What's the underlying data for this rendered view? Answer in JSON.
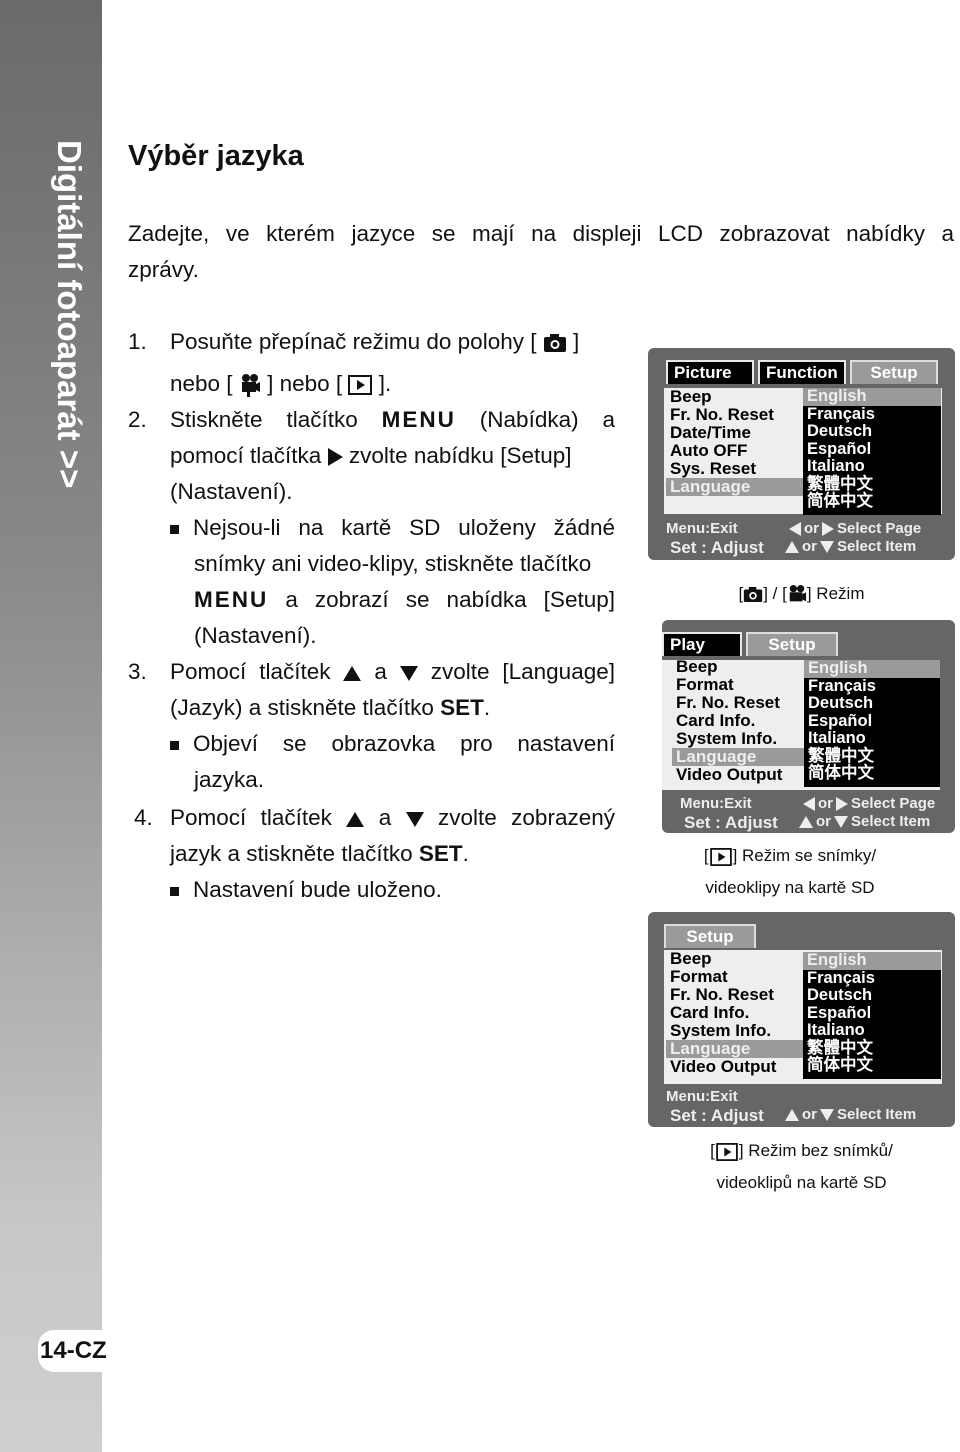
{
  "sidebar": {
    "title": "Digitální fotoaparát >>",
    "page_number": "14-CZ"
  },
  "title": "Výběr jazyka",
  "intro": [
    "Zadejte, ve kterém jazyce se mají na displeji LCD zobrazovat nabídky a",
    "zprávy."
  ],
  "steps": {
    "s1": {
      "num": "1.",
      "a": "Posuňte přepínač režimu do polohy [",
      "b": "]",
      "c": "nebo [",
      "d": "] nebo [",
      "e": "]."
    },
    "s2": {
      "num": "2.",
      "a": "Stiskněte tlačítko",
      "menu": "MENU",
      "b": "(Nabídka) a",
      "c": "pomocí tlačítka",
      "d": "zvolte nabídku [Setup]",
      "e": "(Nastavení).",
      "bullet": [
        "Nejsou-li na kartě SD uloženy žádné",
        "snímky ani video-klipy, stiskněte tlačítko"
      ],
      "bm": "MENU",
      "bl3": "a zobrazí se nabídka [Setup]",
      "bl4": "(Nastavení)."
    },
    "s3": {
      "num": "3.",
      "a": "Pomocí tlačítek",
      "b": "a",
      "c": "zvolte [Language]",
      "d": "(Jazyk) a stiskněte tlačítko",
      "set": "SET",
      "dot": ".",
      "bullet": [
        "Objeví se obrazovka pro nastavení",
        "jazyka."
      ]
    },
    "s4": {
      "num": "4.",
      "a": "Pomocí tlačítek",
      "b": "a",
      "c": "zvolte zobrazený",
      "d": "jazyk a stiskněte tlačítko",
      "set": "SET",
      "dot": ".",
      "bullet": "Nastavení bude uloženo."
    }
  },
  "screens": [
    {
      "tabs": [
        "Picture",
        "Function",
        "Setup"
      ],
      "active_tab": 2,
      "items": [
        "Beep",
        "Fr. No. Reset",
        "Date/Time",
        "Auto OFF",
        "Sys. Reset",
        "Language"
      ],
      "selected_item": 5,
      "languages": [
        "English",
        "Français",
        "Deutsch",
        "Español",
        "Italiano",
        "繁體中文",
        "简体中文"
      ],
      "selected_language": 0,
      "footer": {
        "exit": "Menu:Exit",
        "adjust": "Set : Adjust",
        "or1": "or",
        "page": "Select Page",
        "or2": "or",
        "item": "Select Item"
      },
      "caption": [
        "[",
        "] / [",
        "] Režim"
      ]
    },
    {
      "tabs": [
        "Play",
        "Setup"
      ],
      "active_tab": 1,
      "items": [
        "Beep",
        "Format",
        "Fr. No. Reset",
        "Card Info.",
        "System Info.",
        "Language",
        "Video Output"
      ],
      "selected_item": 5,
      "languages": [
        "English",
        "Français",
        "Deutsch",
        "Español",
        "Italiano",
        "繁體中文",
        "简体中文"
      ],
      "selected_language": 0,
      "footer": {
        "exit": "Menu:Exit",
        "adjust": "Set : Adjust",
        "or1": "or",
        "page": "Select Page",
        "or2": "or",
        "item": "Select Item"
      },
      "caption": [
        "[",
        "] Režim se snímky/",
        "videoklipy na kartě SD"
      ]
    },
    {
      "tabs": [
        "Setup"
      ],
      "active_tab": 0,
      "items": [
        "Beep",
        "Format",
        "Fr. No. Reset",
        "Card Info.",
        "System Info.",
        "Language",
        "Video Output"
      ],
      "selected_item": 5,
      "languages": [
        "English",
        "Français",
        "Deutsch",
        "Español",
        "Italiano",
        "繁體中文",
        "简体中文"
      ],
      "selected_language": 0,
      "footer": {
        "exit": "Menu:Exit",
        "adjust": "Set : Adjust",
        "or2": "or",
        "item": "Select Item"
      },
      "caption": [
        "[",
        "] Režim bez snímků/",
        "videoklipů na kartě SD"
      ]
    }
  ]
}
